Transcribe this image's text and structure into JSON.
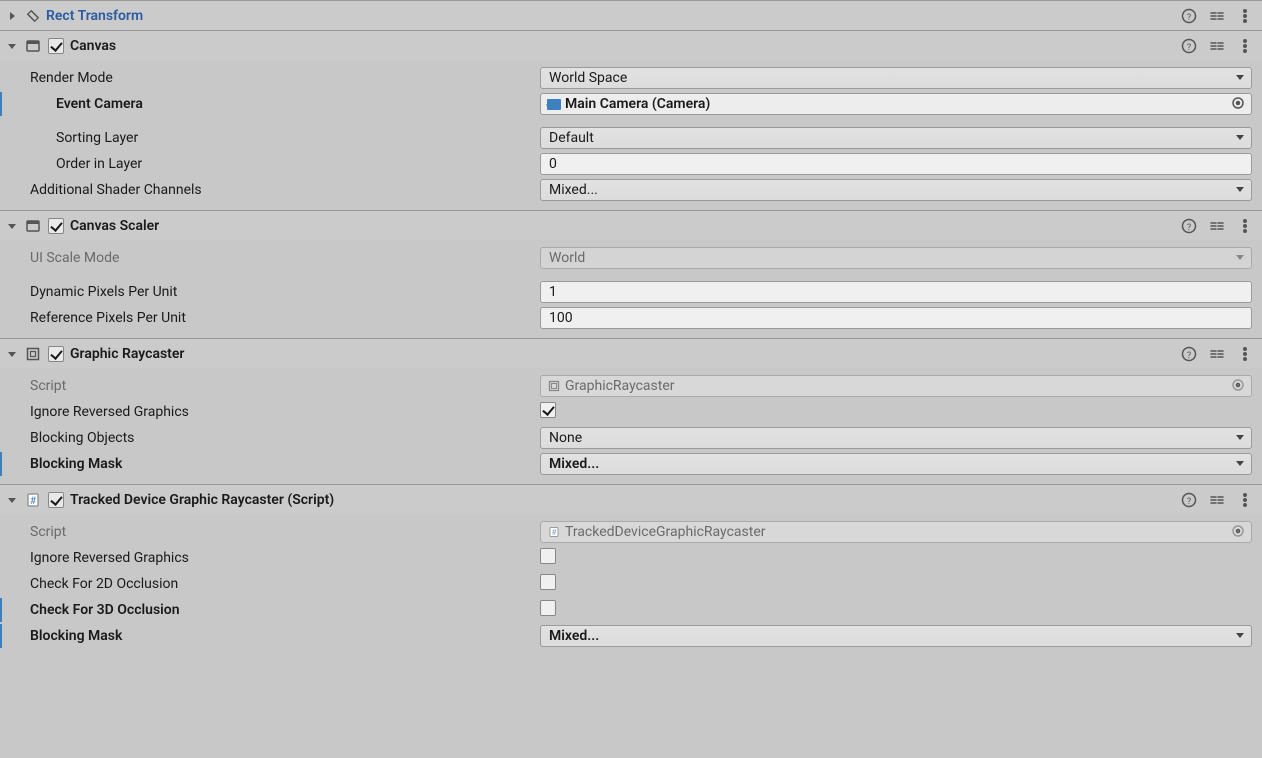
{
  "rectTransform": {
    "title": "Rect Transform"
  },
  "canvas": {
    "title": "Canvas",
    "renderMode": {
      "label": "Render Mode",
      "value": "World Space"
    },
    "eventCamera": {
      "label": "Event Camera",
      "value": "Main Camera (Camera)"
    },
    "sortingLayer": {
      "label": "Sorting Layer",
      "value": "Default"
    },
    "orderInLayer": {
      "label": "Order in Layer",
      "value": "0"
    },
    "additionalShaderChannels": {
      "label": "Additional Shader Channels",
      "value": "Mixed..."
    }
  },
  "canvasScaler": {
    "title": "Canvas Scaler",
    "uiScaleMode": {
      "label": "UI Scale Mode",
      "value": "World"
    },
    "dynamicPixelsPerUnit": {
      "label": "Dynamic Pixels Per Unit",
      "value": "1"
    },
    "referencePixelsPerUnit": {
      "label": "Reference Pixels Per Unit",
      "value": "100"
    }
  },
  "graphicRaycaster": {
    "title": "Graphic Raycaster",
    "script": {
      "label": "Script",
      "value": "GraphicRaycaster"
    },
    "ignoreReversedGraphics": {
      "label": "Ignore Reversed Graphics"
    },
    "blockingObjects": {
      "label": "Blocking Objects",
      "value": "None"
    },
    "blockingMask": {
      "label": "Blocking Mask",
      "value": "Mixed..."
    }
  },
  "trackedRaycaster": {
    "title": "Tracked Device Graphic Raycaster (Script)",
    "script": {
      "label": "Script",
      "value": "TrackedDeviceGraphicRaycaster"
    },
    "ignoreReversedGraphics": {
      "label": "Ignore Reversed Graphics"
    },
    "checkFor2DOcclusion": {
      "label": "Check For 2D Occlusion"
    },
    "checkFor3DOcclusion": {
      "label": "Check For 3D Occlusion"
    },
    "blockingMask": {
      "label": "Blocking Mask",
      "value": "Mixed..."
    }
  }
}
